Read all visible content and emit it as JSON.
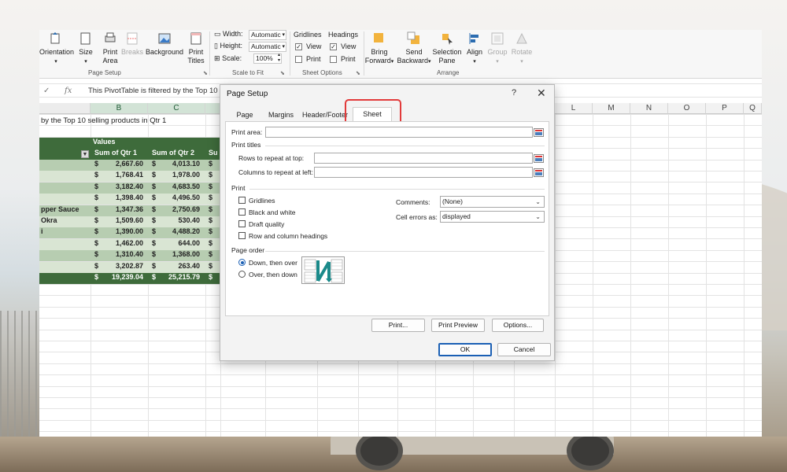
{
  "ribbon": {
    "page_setup": {
      "orientation": "Orientation",
      "size": "Size",
      "print_area": "Print\nArea",
      "breaks": "Breaks",
      "background": "Background",
      "print_titles": "Print\nTitles",
      "group_label": "Page Setup"
    },
    "scale_to_fit": {
      "width_label": "Width:",
      "width_value": "Automatic",
      "height_label": "Height:",
      "height_value": "Automatic",
      "scale_label": "Scale:",
      "scale_value": "100%",
      "group_label": "Scale to Fit"
    },
    "sheet_options": {
      "gridlines": "Gridlines",
      "headings": "Headings",
      "view": "View",
      "print": "Print",
      "group_label": "Sheet Options"
    },
    "arrange": {
      "bring_forward": "Bring\nForward",
      "send_backward": "Send\nBackward",
      "selection_pane": "Selection\nPane",
      "align": "Align",
      "group": "Group",
      "rotate": "Rotate",
      "group_label": "Arrange"
    }
  },
  "formula_bar": {
    "text": "This PivotTable is filtered by the Top 10"
  },
  "columns": {
    "B": "B",
    "C": "C",
    "L": "L",
    "M": "M",
    "N": "N",
    "O": "O",
    "P": "P",
    "Q": "Q"
  },
  "sheet": {
    "title_text": "by the Top 10 selling products in Qtr 1",
    "values_header": "Values",
    "col1_header": "Sum of Qtr 1",
    "col2_header": "Sum of Qtr 2",
    "col3_header_partial": "Su",
    "currency": "$",
    "rows": [
      {
        "label": "",
        "v1": "2,667.60",
        "v2": "4,013.10"
      },
      {
        "label": "",
        "v1": "1,768.41",
        "v2": "1,978.00"
      },
      {
        "label": "",
        "v1": "3,182.40",
        "v2": "4,683.50"
      },
      {
        "label": "",
        "v1": "1,398.40",
        "v2": "4,496.50"
      },
      {
        "label": "pper Sauce",
        "v1": "1,347.36",
        "v2": "2,750.69"
      },
      {
        "label": "Okra",
        "v1": "1,509.60",
        "v2": "530.40"
      },
      {
        "label": "i",
        "v1": "1,390.00",
        "v2": "4,488.20"
      },
      {
        "label": "",
        "v1": "1,462.00",
        "v2": "644.00"
      },
      {
        "label": "",
        "v1": "1,310.40",
        "v2": "1,368.00"
      },
      {
        "label": "",
        "v1": "3,202.87",
        "v2": "263.40"
      }
    ],
    "total": {
      "v1": "19,239.04",
      "v2": "25,215.79"
    }
  },
  "dialog": {
    "title": "Page Setup",
    "help": "?",
    "close": "✕",
    "tabs": [
      "Page",
      "Margins",
      "Header/Footer",
      "Sheet"
    ],
    "active_tab": "Sheet",
    "print_area_label": "Print area:",
    "print_titles_label": "Print titles",
    "rows_repeat_label": "Rows to repeat at top:",
    "cols_repeat_label": "Columns to repeat at left:",
    "print_label": "Print",
    "gridlines_label": "Gridlines",
    "black_white_label": "Black and white",
    "draft_quality_label": "Draft quality",
    "row_col_headings_label": "Row and column headings",
    "comments_label": "Comments:",
    "comments_value": "(None)",
    "cell_errors_label": "Cell errors as:",
    "cell_errors_value": "displayed",
    "page_order_label": "Page order",
    "down_then_over": "Down, then over",
    "over_then_down": "Over, then down",
    "print_button": "Print...",
    "print_preview_button": "Print Preview",
    "options_button": "Options...",
    "ok_button": "OK",
    "cancel_button": "Cancel"
  },
  "colors": {
    "pivot_dark": "#3e6b3b",
    "pivot_light": "#b7cdb1",
    "highlight_red": "#e23a3a",
    "accent_blue": "#1a5fb4"
  }
}
